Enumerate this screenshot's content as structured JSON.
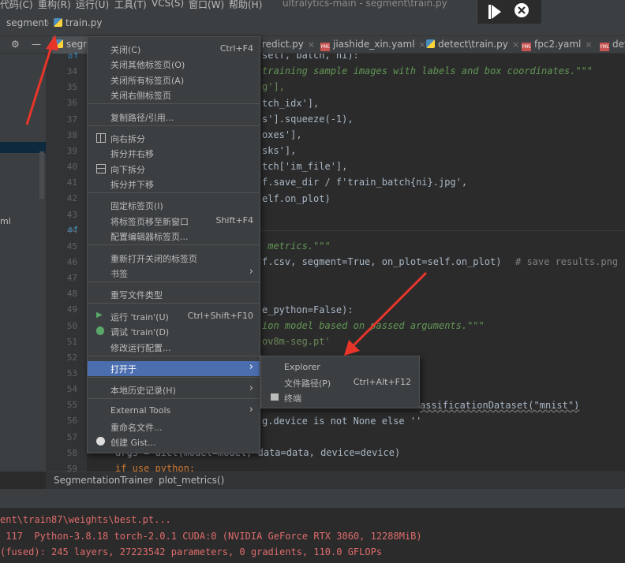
{
  "menubar": {
    "items": [
      "代码(C)",
      "重构(R)",
      "运行(U)",
      "工具(T)",
      "VCS(S)",
      "窗口(W)",
      "帮助(H)"
    ],
    "window_title": "ultralytics-main - segment\\train.py"
  },
  "breadcrumb": {
    "folder": "segment",
    "file": "train.py"
  },
  "tabs": [
    {
      "label": "segm",
      "type": "py"
    },
    {
      "label": "redict.py",
      "type": "py"
    },
    {
      "label": "jiashide_xin.yaml",
      "type": "yaml"
    },
    {
      "label": "detect\\train.py",
      "type": "py"
    },
    {
      "label": "fpc2.yaml",
      "type": "yaml"
    },
    {
      "label": "def",
      "type": "yaml"
    }
  ],
  "gutter": {
    "lines": [
      "34",
      "35",
      "36",
      "37",
      "38",
      "39",
      "40",
      "41",
      "42",
      "43",
      "44",
      "45",
      "46",
      "47",
      "48",
      "49",
      "50",
      "51",
      "52",
      "53",
      "54",
      "55",
      "56",
      "57",
      "58",
      "59"
    ]
  },
  "left_panel": {
    "label": "ml"
  },
  "code": {
    "l34": "self, batch, ni):",
    "l35": "training sample images with labels and box coordinates.\"\"\"",
    "l36": "g'],",
    "l37": "tch_idx'],",
    "l38": "s'].squeeze(-1),",
    "l39": "oxes'],",
    "l40": "sks'],",
    "l41": "tch['im_file'],",
    "l42a": "f.save_dir / f'train_batch{ni}.jpg',",
    "l43": "elf.on_plot)",
    "l46": " metrics.\"\"\"",
    "l47": "f.csv, segment=True, on_plot=self.on_plot)",
    "l47c": "# save results.png",
    "l50": "e_python=False):",
    "l51": "ion model based on passed arguments.\"\"\"",
    "l52": "ov8m-seg.pt'",
    "l56": "assificationDataset(\"mnist\")",
    "l57": "g.device is not None else ''",
    "l59": "args = dict(model=model, data=data, device=device)",
    "l60": "if use_python:"
  },
  "code_crumb": [
    "SegmentationTrainer",
    "plot_metrics()"
  ],
  "console": {
    "lines": [
      "ent\\train87\\weights\\best.pt...",
      " 117  Python-3.8.18 torch-2.0.1 CUDA:0 (NVIDIA GeForce RTX 3060, 12288MiB)",
      "(fused): 245 layers, 27223542 parameters, 0 gradients, 110.0 GFLOPs"
    ]
  },
  "context_menu": {
    "close": "关闭(C)",
    "close_shortcut": "Ctrl+F4",
    "close_others": "关闭其他标签页(O)",
    "close_all": "关闭所有标签页(A)",
    "close_right": "关闭右侧标签页",
    "copy_path": "复制路径/引用...",
    "split_right": "向右拆分",
    "split_move_right": "拆分并右移",
    "split_down": "向下拆分",
    "split_move_down": "拆分并下移",
    "pin_tab": "固定标签页(I)",
    "move_to_window": "将标签页移至新窗口",
    "move_to_window_shortcut": "Shift+F4",
    "config_tabs": "配置编辑器标签页...",
    "reopen_closed": "重新打开关闭的标签页",
    "bookmarks": "书签",
    "override_type": "重写文件类型",
    "run": "运行 'train'(U)",
    "run_shortcut": "Ctrl+Shift+F10",
    "debug": "调试 'train'(D)",
    "modify_run": "修改运行配置...",
    "open_in": "打开于",
    "local_history": "本地历史记录(H)",
    "external_tools": "External Tools",
    "rename_file": "重命名文件...",
    "create_gist": "创建 Gist..."
  },
  "submenu": {
    "explorer": "Explorer",
    "file_path": "文件路径(P)",
    "file_path_shortcut": "Ctrl+Alt+F12",
    "terminal": "终端"
  },
  "colors": {
    "accent_selected": "#4b6eaf",
    "annotation_arrow": "#e8352a"
  }
}
